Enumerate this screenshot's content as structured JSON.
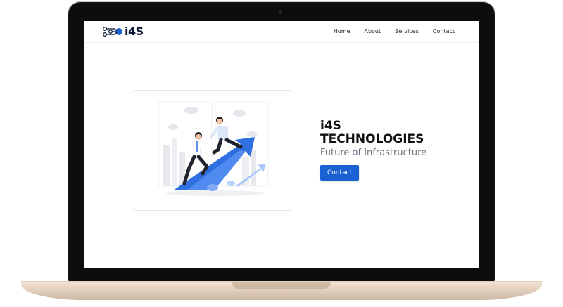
{
  "brand": {
    "logo_text": "i4S"
  },
  "nav": {
    "items": [
      {
        "label": "Home"
      },
      {
        "label": "About"
      },
      {
        "label": "Services"
      },
      {
        "label": "Contact"
      }
    ]
  },
  "hero": {
    "title_line1": "i4S",
    "title_line2": "TECHNOLOGIES",
    "tagline": "Future of Infrastructure",
    "cta_label": "Contact"
  },
  "colors": {
    "accent": "#1a62d4",
    "dark": "#0c1533",
    "tagline": "#6b7280"
  },
  "icons": [
    "logo-circuit-icon",
    "illustration-teamwork-growth"
  ]
}
